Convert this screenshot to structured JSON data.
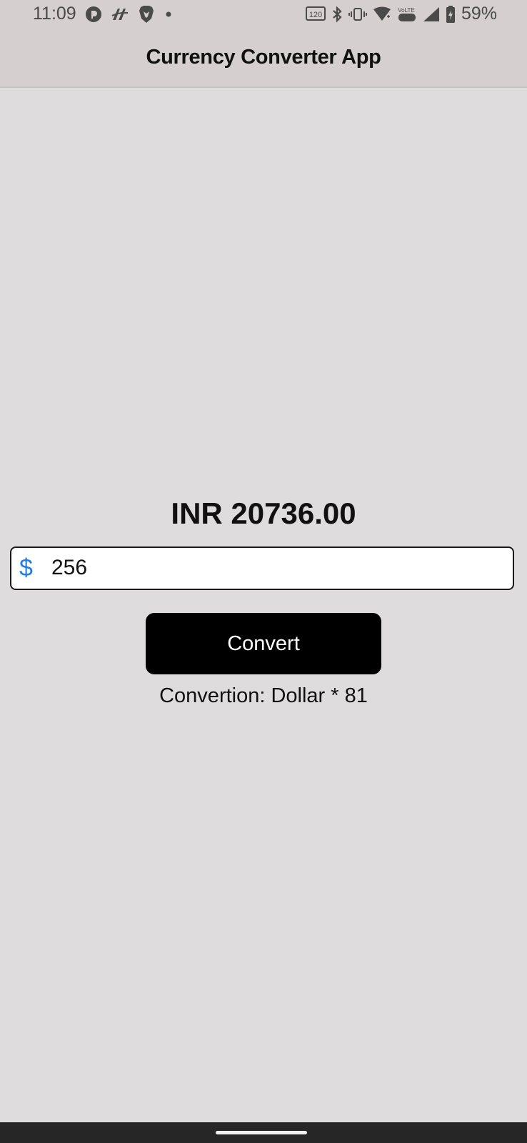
{
  "status_bar": {
    "time": "11:09",
    "battery": "59%",
    "refresh_rate_badge": "120",
    "volte_badge": "VoLTE",
    "left_icons": [
      "pocket-casts-icon",
      "messenger-icon",
      "brave-icon",
      "dot-icon"
    ],
    "right_icons": [
      "refresh-rate-icon",
      "bluetooth-icon",
      "vibrate-icon",
      "wifi-icon",
      "volte-icon",
      "signal-icon",
      "battery-icon"
    ]
  },
  "app_bar": {
    "title": "Currency Converter App"
  },
  "result": {
    "text": "INR 20736.00"
  },
  "amount_field": {
    "currency_symbol": "$",
    "value": "256",
    "icon": "dollar-icon"
  },
  "convert_button": {
    "label": "Convert"
  },
  "conversion_note": {
    "text": "Convertion: Dollar * 81"
  },
  "colors": {
    "background": "#dedcdd",
    "app_bar": "#d6cfcf",
    "accent": "#1f7fe0",
    "button": "#000000"
  }
}
